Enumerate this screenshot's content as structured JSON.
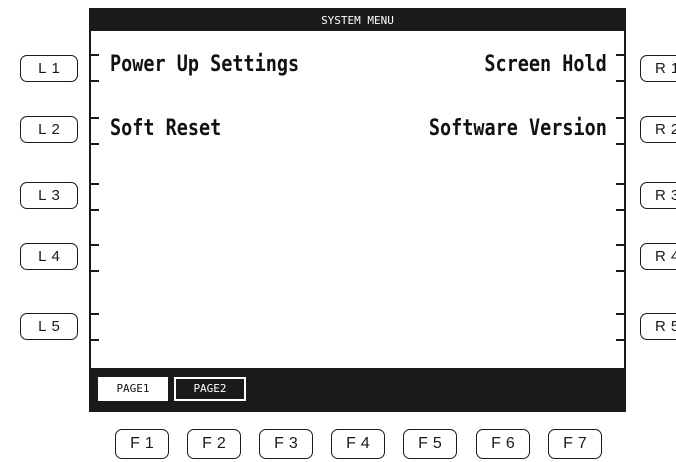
{
  "screen": {
    "title": "SYSTEM MENU",
    "left_items": [
      "Power Up Settings",
      "Soft Reset",
      "",
      "",
      ""
    ],
    "right_items": [
      "Screen Hold",
      "Software Version",
      "",
      "",
      ""
    ],
    "pages": [
      {
        "label": "PAGE1",
        "selected": true
      },
      {
        "label": "PAGE2",
        "selected": false
      }
    ]
  },
  "buttons": {
    "left": [
      "L1",
      "L2",
      "L3",
      "L4",
      "L5"
    ],
    "right": [
      "R1",
      "R2",
      "R3",
      "R4",
      "R5"
    ],
    "function": [
      "F1",
      "F2",
      "F3",
      "F4",
      "F5",
      "F6",
      "F7"
    ]
  }
}
